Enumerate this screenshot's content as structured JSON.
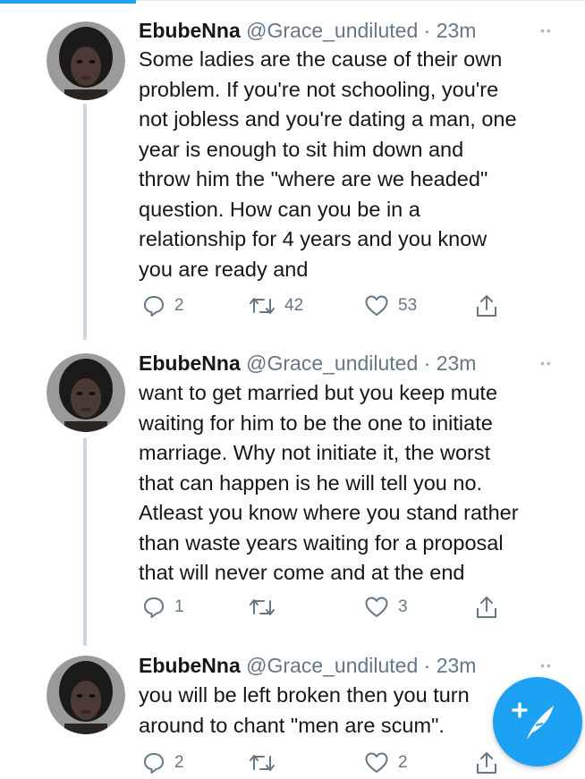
{
  "tweets": [
    {
      "name": "EbubeNna",
      "handle": "@Grace_undiluted",
      "separator": "·",
      "time": "23m",
      "text": "Some ladies are the cause of their own\nproblem. If you're not schooling, you're\nnot jobless and you're dating a man, one\nyear is enough to sit him down and\nthrow him the \"where are we headed\"\nquestion. How can you be in a\nrelationship for 4 years and you know\nyou are ready and",
      "replies": "2",
      "retweets": "42",
      "likes": "53"
    },
    {
      "name": "EbubeNna",
      "handle": "@Grace_undiluted",
      "separator": "·",
      "time": "23m",
      "text": "want to get married but you keep mute\nwaiting for him to be the one to initiate\nmarriage. Why not initiate it, the worst\nthat can happen is he will tell you no.\nAtleast you know where you stand rather\nthan waste years waiting for a proposal\nthat will never come and at the end",
      "replies": "1",
      "retweets": "",
      "likes": "3"
    },
    {
      "name": "EbubeNna",
      "handle": "@Grace_undiluted",
      "separator": "·",
      "time": "23m",
      "text": "you will be left broken then you turn\naround to chant \"men are scum\".",
      "replies": "2",
      "retweets": "",
      "likes": "2"
    }
  ],
  "icons": {
    "reply": "reply-icon",
    "retweet": "retweet-icon",
    "like": "heart-icon",
    "share": "share-icon",
    "compose": "compose-tweet-icon",
    "more": "more-options-icon"
  },
  "colors": {
    "accent": "#1da1f2",
    "secondary_text": "#657786",
    "thread_line": "#ccd6dd"
  }
}
